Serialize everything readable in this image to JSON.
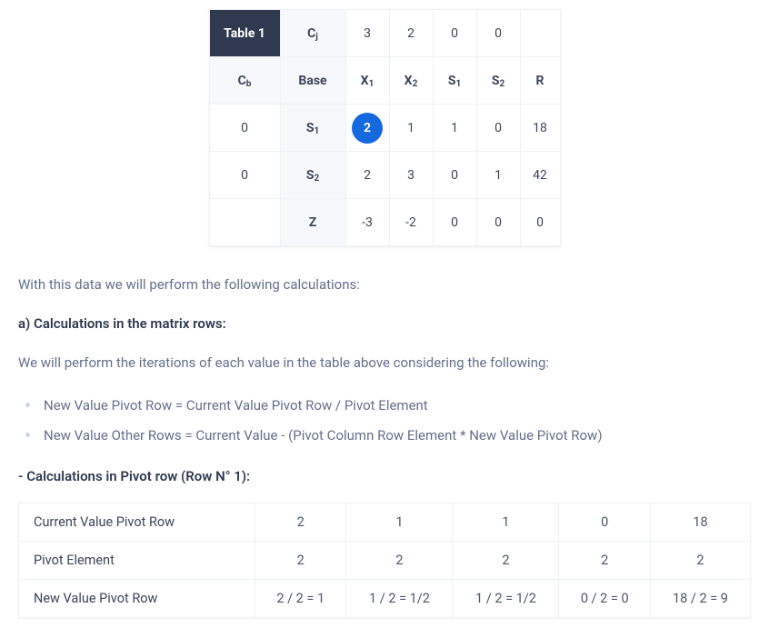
{
  "table1": {
    "title": "Table 1",
    "cj_label": "C<sub>j</sub>",
    "cj_vals": [
      "3",
      "2",
      "0",
      "0"
    ],
    "header2": {
      "cb": "C<sub>b</sub>",
      "base": "Base",
      "cols": [
        "X<sub>1</sub>",
        "X<sub>2</sub>",
        "S<sub>1</sub>",
        "S<sub>2</sub>"
      ],
      "r": "R"
    },
    "rows": [
      {
        "cb": "0",
        "base": "S<sub>1</sub>",
        "vals": [
          "2",
          "1",
          "1",
          "0"
        ],
        "r": "18",
        "pivotIndex": 0
      },
      {
        "cb": "0",
        "base": "S<sub>2</sub>",
        "vals": [
          "2",
          "3",
          "0",
          "1"
        ],
        "r": "42"
      }
    ],
    "zrow": {
      "label": "Z",
      "vals": [
        "-3",
        "-2",
        "0",
        "0"
      ],
      "r": "0"
    }
  },
  "text": {
    "intro": "With this data we will perform the following calculations:",
    "section_a": "a) Calculations in the matrix rows:",
    "iter_desc": "We will perform the iterations of each value in the table above considering the following:",
    "rule1": "New Value Pivot Row = Current Value Pivot Row / Pivot Element",
    "rule2": "New Value Other Rows = Current Value - (Pivot Column Row Element * New Value Pivot Row)",
    "pivot_row_heading": "- Calculations in Pivot row (Row N° 1):"
  },
  "table2": {
    "rows": [
      {
        "label": "Current Value Pivot Row",
        "cells": [
          "2",
          "1",
          "1",
          "0",
          "18"
        ]
      },
      {
        "label": "Pivot Element",
        "cells": [
          "2",
          "2",
          "2",
          "2",
          "2"
        ]
      },
      {
        "label": "New Value Pivot Row",
        "cells": [
          "2 / 2 = 1",
          "1 / 2 = 1/2",
          "1 / 2 = 1/2",
          "0 / 2 = 0",
          "18 / 2 = 9"
        ]
      }
    ]
  }
}
